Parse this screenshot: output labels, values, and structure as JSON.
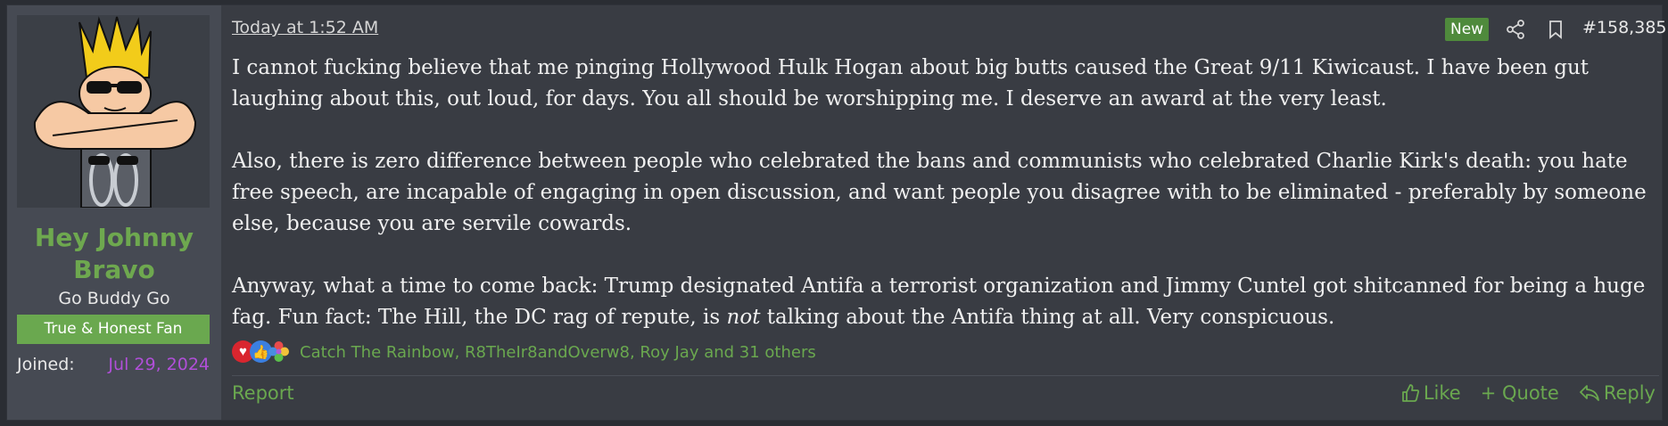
{
  "user": {
    "name": "Hey Johnny Bravo",
    "title": "Go Buddy Go",
    "banner": "True & Honest Fan",
    "joined_label": "Joined:",
    "joined_date": "Jul 29, 2024",
    "avatar_icon": "cartoon-avatar-icon"
  },
  "post": {
    "timestamp": "Today at 1:52 AM",
    "new_badge": "New",
    "post_number": "#158,385",
    "paragraphs": {
      "p1": "I cannot fucking believe that me pinging Hollywood Hulk Hogan about big butts caused the Great 9/11 Kiwicaust. I have been gut laughing about this, out loud, for days. You all should be worshipping me. I deserve an award at the very least.",
      "p2": "Also, there is zero difference between people who celebrated the bans and communists who celebrated Charlie Kirk's death: you hate free speech, are incapable of engaging in open discussion, and want people you disagree with to be eliminated - preferably by someone else, because you are servile cowards.",
      "p3_a": "Anyway, what a time to come back: Trump designated Antifa a terrorist organization and Jimmy Cuntel got shitcanned for being a huge fag. Fun fact: The Hill, the DC rag of repute, is ",
      "p3_em": "not",
      "p3_b": " talking about the Antifa thing at all. Very conspicuous."
    },
    "reactions": {
      "icons": [
        "heart-icon",
        "thumbs-up-icon",
        "rainbow-flower-icon"
      ],
      "names": "Catch The Rainbow, R8TheIr8andOverw8, Roy Jay and 31 others"
    }
  },
  "footer": {
    "report": "Report",
    "like": "Like",
    "quote": "+ Quote",
    "reply": "Reply"
  },
  "colors": {
    "accent_green": "#6aa84f",
    "joined_purple": "#b04fd8",
    "post_bg": "#393c43",
    "sidebar_bg": "#464a53"
  }
}
